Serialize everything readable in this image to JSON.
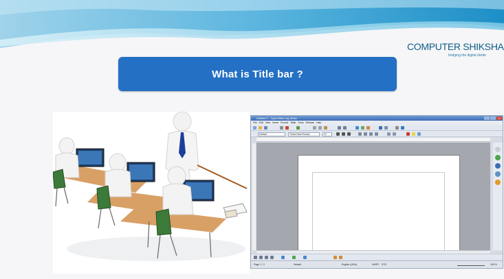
{
  "logo": {
    "main": "COMPUTER SHIKSHA",
    "tagline": "bridging the digital divide"
  },
  "title": "What is Title bar ?",
  "writer_window": {
    "title": "Untitled 1 - OpenOffice.org Writer",
    "menu_items": [
      "File",
      "Edit",
      "View",
      "Insert",
      "Format",
      "Table",
      "Tools",
      "Window",
      "Help"
    ],
    "style_value": "Default",
    "font_value": "Times New Roman",
    "size_value": "12",
    "status": {
      "page": "Page 1 / 1",
      "style": "Default",
      "language": "English (USA)",
      "mode": "INSRT",
      "selection": "STD",
      "zoom": "100 %"
    }
  }
}
